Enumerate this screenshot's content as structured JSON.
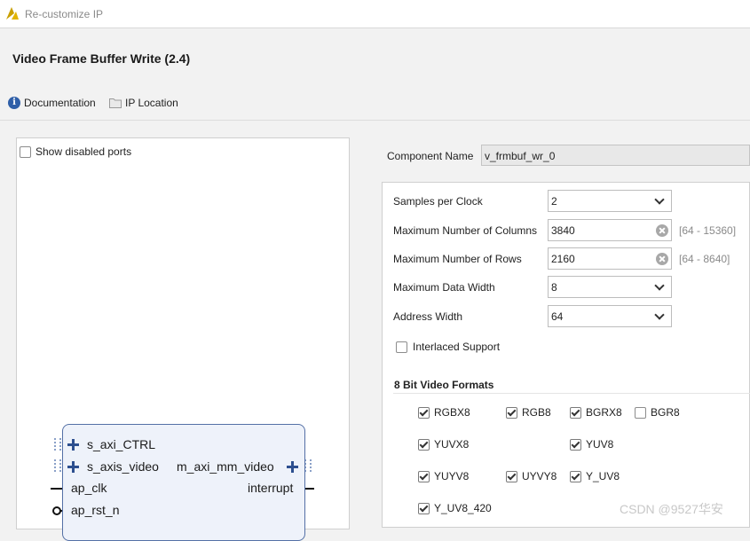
{
  "window": {
    "title": "Re-customize IP"
  },
  "header": {
    "ip_title": "Video Frame Buffer Write (2.4)",
    "links": {
      "documentation": "Documentation",
      "ip_location": "IP Location"
    }
  },
  "symbol": {
    "show_disabled_label": "Show disabled ports",
    "show_disabled_checked": false,
    "ports_left": [
      "s_axi_CTRL",
      "s_axis_video",
      "ap_clk",
      "ap_rst_n"
    ],
    "ports_right": [
      "m_axi_mm_video",
      "interrupt"
    ]
  },
  "component": {
    "label": "Component Name",
    "value": "v_frmbuf_wr_0"
  },
  "params": {
    "samples_per_clock": {
      "label": "Samples per Clock",
      "value": "2"
    },
    "max_columns": {
      "label": "Maximum Number of Columns",
      "value": "3840",
      "range": "[64 - 15360]"
    },
    "max_rows": {
      "label": "Maximum Number of Rows",
      "value": "2160",
      "range": "[64 - 8640]"
    },
    "max_data_width": {
      "label": "Maximum Data Width",
      "value": "8"
    },
    "address_width": {
      "label": "Address Width",
      "value": "64"
    },
    "interlaced": {
      "label": "Interlaced Support",
      "checked": false
    }
  },
  "formats": {
    "heading": "8 Bit Video Formats",
    "items": [
      {
        "label": "RGBX8",
        "checked": true
      },
      {
        "label": "RGB8",
        "checked": true
      },
      {
        "label": "BGRX8",
        "checked": true
      },
      {
        "label": "BGR8",
        "checked": false
      },
      {
        "label": "YUVX8",
        "checked": true
      },
      {
        "label": "YUV8",
        "checked": true
      },
      {
        "label": "YUYV8",
        "checked": true
      },
      {
        "label": "UYVY8",
        "checked": true
      },
      {
        "label": "Y_UV8",
        "checked": true
      },
      {
        "label": "Y_UV8_420",
        "checked": true
      }
    ]
  },
  "watermark": "CSDN @9527华安"
}
